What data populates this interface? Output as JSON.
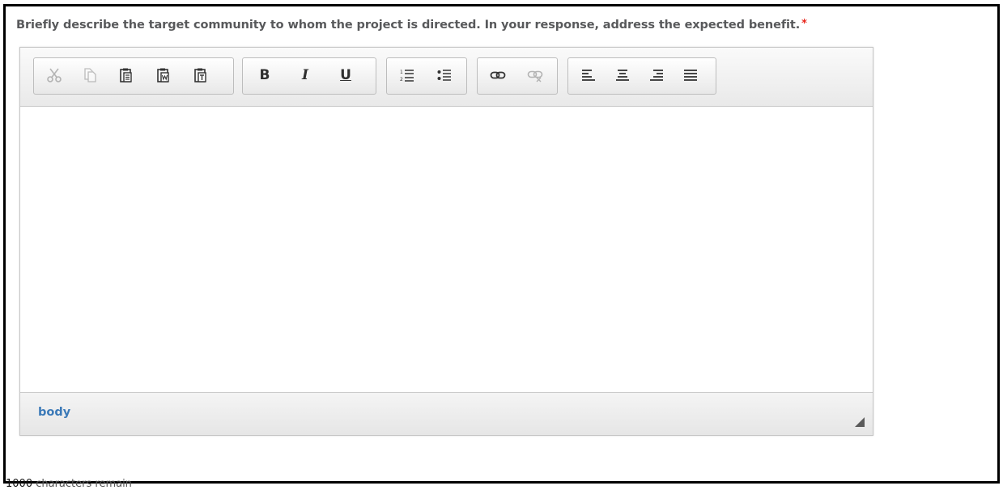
{
  "form": {
    "question": "Briefly describe the target community to whom the project is directed. In your response, address the expected benefit.",
    "required_marker": "*"
  },
  "editor": {
    "toolbar": {
      "groups": [
        {
          "name": "clipboard",
          "buttons": [
            {
              "icon": "cut-icon",
              "label": "Cut",
              "enabled": false
            },
            {
              "icon": "copy-icon",
              "label": "Copy",
              "enabled": false
            },
            {
              "icon": "paste-icon",
              "label": "Paste",
              "enabled": true
            },
            {
              "icon": "paste-from-word-icon",
              "label": "Paste from Word",
              "enabled": true
            },
            {
              "icon": "paste-as-text-icon",
              "label": "Paste as plain text",
              "enabled": true
            }
          ]
        },
        {
          "name": "basicstyles",
          "buttons": [
            {
              "icon": "bold-icon",
              "label": "B",
              "enabled": true
            },
            {
              "icon": "italic-icon",
              "label": "I",
              "enabled": true
            },
            {
              "icon": "underline-icon",
              "label": "U",
              "enabled": true
            }
          ]
        },
        {
          "name": "lists",
          "buttons": [
            {
              "icon": "numbered-list-icon",
              "label": "Numbered List",
              "enabled": true
            },
            {
              "icon": "bulleted-list-icon",
              "label": "Bulleted List",
              "enabled": true
            }
          ]
        },
        {
          "name": "links",
          "buttons": [
            {
              "icon": "link-icon",
              "label": "Link",
              "enabled": true
            },
            {
              "icon": "unlink-icon",
              "label": "Unlink",
              "enabled": false
            }
          ]
        },
        {
          "name": "align",
          "buttons": [
            {
              "icon": "align-left-icon",
              "label": "Align Left",
              "enabled": true
            },
            {
              "icon": "align-center-icon",
              "label": "Center",
              "enabled": true
            },
            {
              "icon": "align-right-icon",
              "label": "Align Right",
              "enabled": true
            },
            {
              "icon": "align-justify-icon",
              "label": "Justify",
              "enabled": true
            }
          ]
        }
      ]
    },
    "content_text": "",
    "element_path": "body"
  },
  "counter": {
    "count": "1000",
    "suffix": " characters remain"
  },
  "colors": {
    "required": "#e8261c",
    "path_link": "#3c7ab8",
    "label_text": "#58595b"
  }
}
